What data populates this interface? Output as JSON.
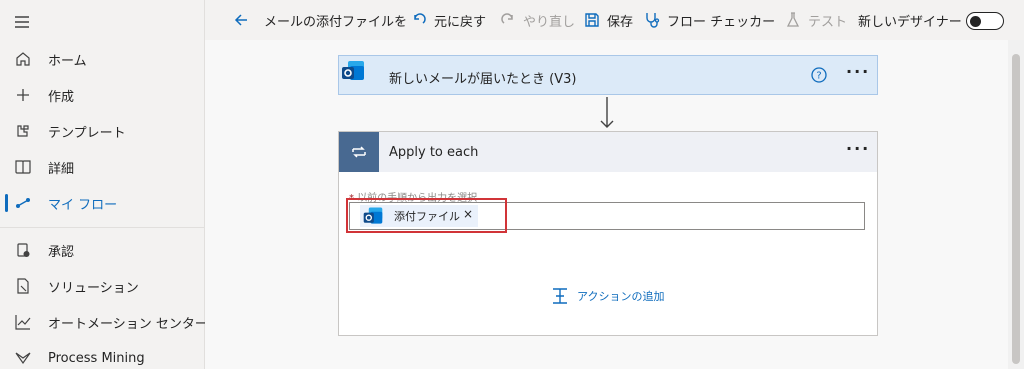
{
  "sidebar": {
    "items": [
      {
        "label": "ホーム",
        "icon": "home-icon"
      },
      {
        "label": "作成",
        "icon": "plus-icon"
      },
      {
        "label": "テンプレート",
        "icon": "template-icon"
      },
      {
        "label": "詳細",
        "icon": "book-icon"
      },
      {
        "label": "マイ フロー",
        "icon": "flow-icon",
        "active": true
      },
      {
        "label": "承認",
        "icon": "approval-icon"
      },
      {
        "label": "ソリューション",
        "icon": "solution-icon"
      },
      {
        "label": "オートメーション センター",
        "icon": "chart-icon"
      },
      {
        "label": "Process Mining",
        "icon": "process-mining-icon"
      }
    ]
  },
  "toolbar": {
    "flow_name": "メールの添付ファイルを",
    "undo": "元に戻す",
    "redo": "やり直し",
    "save": "保存",
    "flow_checker": "フロー チェッカー",
    "test": "テスト",
    "new_designer": "新しいデザイナー",
    "new_designer_on": false
  },
  "trigger": {
    "title": "新しいメールが届いたとき (V3)"
  },
  "loop": {
    "title": "Apply to each",
    "field_required_mark": "*",
    "field_label": "以前の手順から出力を選択",
    "token_label": "添付ファイル",
    "token_remove": "×",
    "add_action": "アクションの追加"
  },
  "colors": {
    "accent": "#0f6cbd",
    "trigger_bg": "#dceaf8",
    "loop_header_icon_bg": "#486991",
    "highlight": "#d13438"
  }
}
